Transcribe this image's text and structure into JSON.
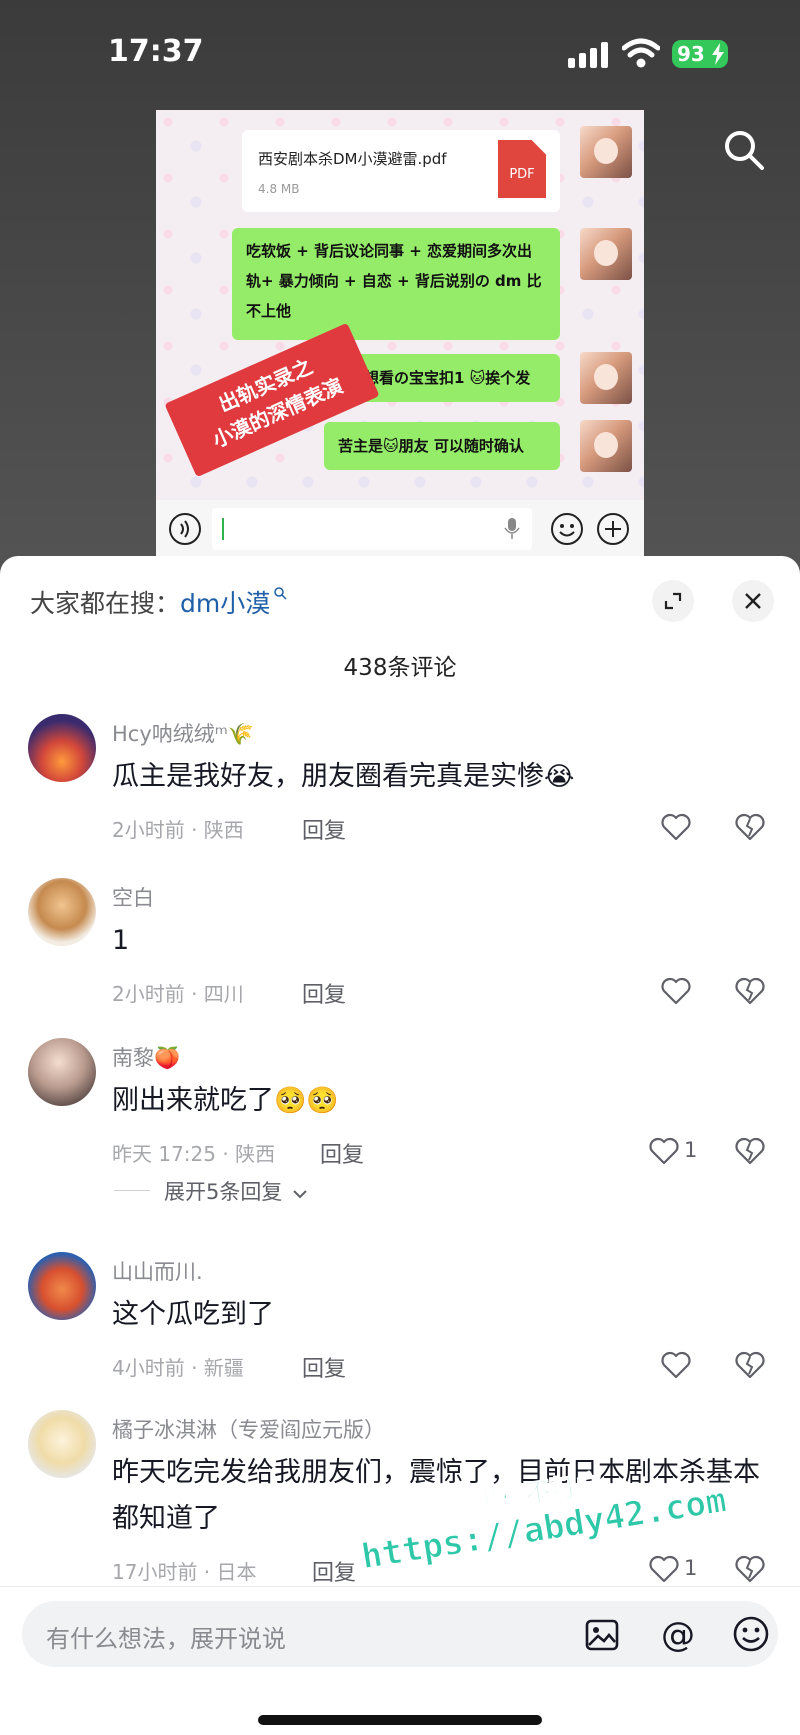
{
  "status_bar": {
    "time": "17:37",
    "battery": "93"
  },
  "chat_image": {
    "file_name": "西安剧本杀DM小漠避雷.pdf",
    "file_size": "4.8 MB",
    "file_type": "PDF",
    "messages": [
      "吃软饭 + 背后议论同事 + 恋爱期间多次出轨+ 暴力倾向 + 自恋 + 背后说别の dm 比不上他",
      "想看の宝宝扣1 🐱挨个发",
      "苦主是🐱朋友  可以随时确认"
    ],
    "stamp_line1": "出轨实录之",
    "stamp_line2": "小漠的深情表演"
  },
  "sheet": {
    "search_prefix": "大家都在搜：",
    "search_keyword": "dm小漠",
    "comment_count": "438条评论"
  },
  "comments": [
    {
      "user": "Hcy呐绒绒ᵐ🌾",
      "text": "瓜主是我好友，朋友圈看完真是实惨",
      "emoji": "😭",
      "meta": "2小时前 · 陕西",
      "reply": "回复",
      "likes": ""
    },
    {
      "user": "空白",
      "text": "1",
      "meta": "2小时前 · 四川",
      "reply": "回复",
      "likes": ""
    },
    {
      "user": "南黎🍑",
      "text": "刚出来就吃了",
      "emoji": "🥺🥺",
      "meta": "昨天 17:25 · 陕西",
      "reply": "回复",
      "likes": "1"
    },
    {
      "user": "山山而川.",
      "text": "这个瓜吃到了",
      "meta": "4小时前 · 新疆",
      "reply": "回复",
      "likes": ""
    },
    {
      "user": "橘子冰淇淋（专爱阎应元版）",
      "text": "昨天吃完发给我朋友们，震惊了，目前日本剧本杀基本都知道了",
      "meta": "17小时前 · 日本",
      "reply": "回复",
      "likes": "1"
    }
  ],
  "expand_replies": "展开5条回复",
  "watermark": {
    "line1": "黑料不打烊",
    "line2": "https://abdy42.com"
  },
  "input": {
    "placeholder": "有什么想法，展开说说"
  },
  "colors": {
    "keyword": "#1e5fa8",
    "bubble": "#95ec69",
    "battery": "#34c759",
    "watermark": "#2ec8a8"
  }
}
